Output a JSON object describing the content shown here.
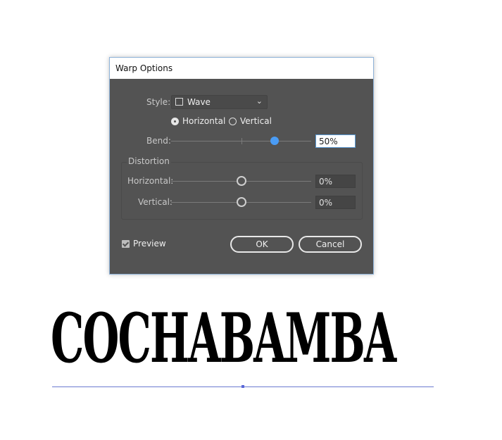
{
  "dialog": {
    "title": "Warp Options",
    "style_label": "Style:",
    "style_value": "Wave",
    "style_icon": "wave-style-icon",
    "orientation": {
      "options": [
        "Horizontal",
        "Vertical"
      ],
      "selected": "Horizontal"
    },
    "bend": {
      "label": "Bend:",
      "value": "50%",
      "fraction": 0.75
    },
    "distortion": {
      "group_label": "Distortion",
      "horizontal": {
        "label": "Horizontal:",
        "value": "0%",
        "fraction": 0.5
      },
      "vertical": {
        "label": "Vertical:",
        "value": "0%",
        "fraction": 0.5
      }
    },
    "preview": {
      "label": "Preview",
      "checked": true
    },
    "ok_label": "OK",
    "cancel_label": "Cancel",
    "accent_color": "#4a9cf5"
  },
  "canvas": {
    "text": "COCHABAMBA",
    "baseline_color": "#6b7bd0"
  }
}
